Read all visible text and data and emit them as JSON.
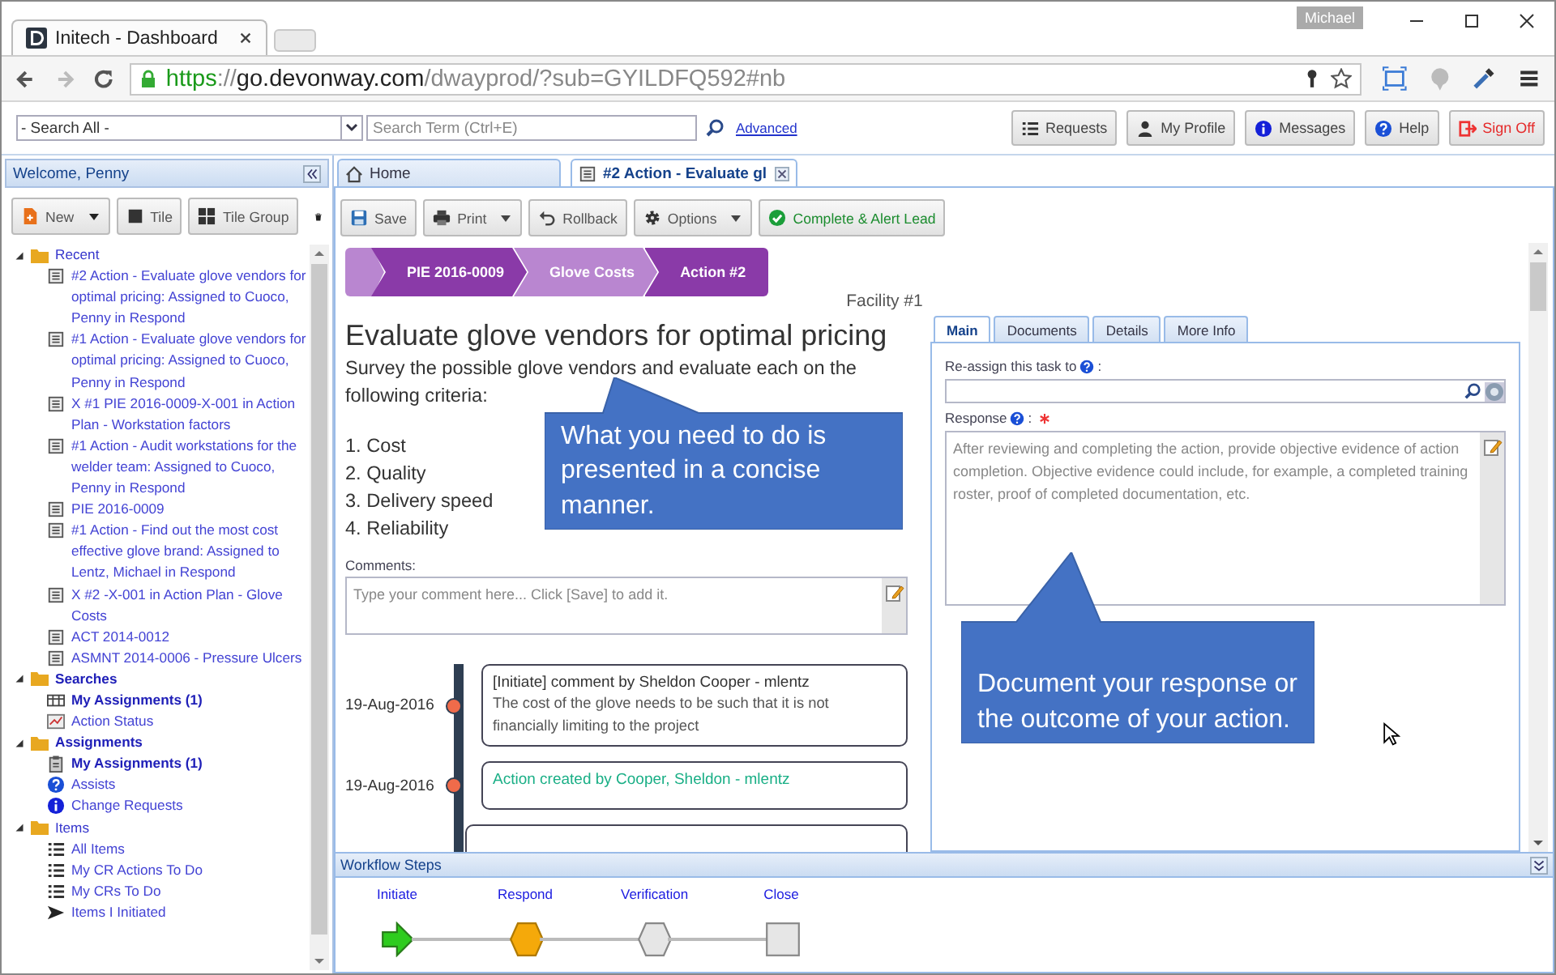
{
  "browser": {
    "tab_title": "Initech - Dashboard",
    "user_badge": "Michael",
    "url": [
      {
        "kind": "scheme",
        "text": "https"
      },
      {
        "kind": "sep",
        "text": "://"
      },
      {
        "kind": "host",
        "text": "go.devonway.com"
      },
      {
        "kind": "path",
        "text": "/dwayprod/?sub=GYILDFQ592#nb"
      }
    ]
  },
  "app_toolbar": {
    "search_scope": "- Search All -",
    "search_placeholder": "Search Term (Ctrl+E)",
    "advanced_link": "Advanced",
    "buttons": [
      {
        "label": "Requests",
        "kind": "list"
      },
      {
        "label": "My Profile",
        "kind": "person"
      },
      {
        "label": "Messages",
        "kind": "info"
      },
      {
        "label": "Help",
        "kind": "help"
      },
      {
        "label": "Sign Off",
        "kind": "signoff"
      }
    ]
  },
  "sidebar": {
    "welcome": "Welcome, Penny",
    "buttons": [
      {
        "label": "New",
        "kind": "new",
        "dropdown": true
      },
      {
        "label": "Tile",
        "kind": "tile",
        "dropdown": false
      },
      {
        "label": "Tile Group",
        "kind": "tilegroup",
        "dropdown": false
      }
    ],
    "tree": [
      {
        "label": "Recent",
        "expanded": true,
        "bold": false,
        "children": [
          {
            "label": "#2 Action - Evaluate glove vendors for optimal pricing: Assigned to Cuoco, Penny in Respond",
            "kind": "document",
            "bold": false
          },
          {
            "label": "#1 Action - Evaluate glove vendors for optimal pricing: Assigned to Cuoco, Penny in Respond",
            "kind": "document",
            "bold": false
          },
          {
            "label": "X #1 PIE 2016-0009-X-001 in Action Plan - Workstation factors",
            "kind": "document",
            "bold": false
          },
          {
            "label": "#1 Action - Audit workstations for the welder team: Assigned to Cuoco, Penny in Respond",
            "kind": "document",
            "bold": false
          },
          {
            "label": "PIE 2016-0009",
            "kind": "document",
            "bold": false
          },
          {
            "label": "#1 Action - Find out the most cost effective glove brand: Assigned to Lentz, Michael in Respond",
            "kind": "document",
            "bold": false
          },
          {
            "label": "X #2 -X-001 in Action Plan - Glove Costs",
            "kind": "document",
            "bold": false
          },
          {
            "label": "ACT 2014-0012",
            "kind": "document",
            "bold": false
          },
          {
            "label": "ASMNT 2014-0006 - Pressure Ulcers",
            "kind": "document",
            "bold": false
          }
        ]
      },
      {
        "label": "Searches",
        "expanded": true,
        "bold": true,
        "children": [
          {
            "label": "My Assignments (1)",
            "kind": "table",
            "bold": true
          },
          {
            "label": "Action Status",
            "kind": "chart",
            "bold": false
          }
        ]
      },
      {
        "label": "Assignments",
        "expanded": true,
        "bold": true,
        "children": [
          {
            "label": "My Assignments (1)",
            "kind": "clipboard",
            "bold": true
          },
          {
            "label": "Assists",
            "kind": "help",
            "bold": false
          },
          {
            "label": "Change Requests",
            "kind": "info",
            "bold": false
          }
        ]
      },
      {
        "label": "Items",
        "expanded": true,
        "bold": false,
        "children": [
          {
            "label": "All Items",
            "kind": "list",
            "bold": false
          },
          {
            "label": "My CR Actions To Do",
            "kind": "list",
            "bold": false
          },
          {
            "label": "My CRs To Do",
            "kind": "list",
            "bold": false
          },
          {
            "label": "Items I Initiated",
            "kind": "send",
            "bold": false
          }
        ]
      }
    ]
  },
  "content_tabs": [
    {
      "label": "Home",
      "kind": "home",
      "selected": false,
      "closable": false
    },
    {
      "label": "#2 Action - Evaluate gl",
      "kind": "document",
      "selected": true,
      "closable": true
    }
  ],
  "action_toolbar": [
    {
      "label": "Save",
      "kind": "save",
      "dropdown": false
    },
    {
      "label": "Print",
      "kind": "print",
      "dropdown": true
    },
    {
      "label": "Rollback",
      "kind": "rollback",
      "dropdown": false
    },
    {
      "label": "Options",
      "kind": "options",
      "dropdown": true
    },
    {
      "label": "Complete & Alert Lead",
      "kind": "complete",
      "dropdown": false
    }
  ],
  "breadcrumb": [
    {
      "label": "PIE 2016-0009"
    },
    {
      "label": "Glove Costs"
    },
    {
      "label": "Action #2"
    }
  ],
  "facility": "Facility #1",
  "title": "Evaluate glove vendors for optimal pricing",
  "description": "Survey the possible glove vendors and evaluate each on the following criteria:",
  "criteria": [
    "1. Cost",
    "2. Quality",
    "3. Delivery speed",
    "4. Reliability"
  ],
  "comments": {
    "label": "Comments:",
    "placeholder": "Type your comment here... Click [Save] to add it."
  },
  "timeline": [
    {
      "date": "19-Aug-2016",
      "kind": "comment",
      "title": "[Initiate] comment by Sheldon Cooper - mlentz",
      "body": "The cost of the glove needs to be such that it is not financially limiting to the project"
    },
    {
      "date": "19-Aug-2016",
      "kind": "event",
      "title": "Action created by Cooper, Sheldon - mlentz"
    }
  ],
  "detail_tabs": [
    {
      "label": "Main",
      "selected": true
    },
    {
      "label": "Documents",
      "selected": false
    },
    {
      "label": "Details",
      "selected": false
    },
    {
      "label": "More Info",
      "selected": false
    }
  ],
  "reassign": {
    "label": "Re-assign this task to",
    "colon": ":"
  },
  "response": {
    "label": "Response",
    "colon": ":",
    "required": true,
    "placeholder": "After reviewing and completing the action, provide objective evidence of action completion. Objective evidence could include, for example, a completed training roster, proof of completed documentation, etc."
  },
  "workflow": {
    "title": "Workflow Steps",
    "steps": [
      {
        "label": "Initiate",
        "kind": "start",
        "done": true,
        "current": false
      },
      {
        "label": "Respond",
        "kind": "step",
        "done": false,
        "current": true
      },
      {
        "label": "Verification",
        "kind": "step",
        "done": false,
        "current": false
      },
      {
        "label": "Close",
        "kind": "end",
        "done": false,
        "current": false
      }
    ]
  },
  "callouts": [
    {
      "text": "What you need to do is presented in a concise manner."
    },
    {
      "text": "Document your response or the outcome of your action."
    }
  ]
}
